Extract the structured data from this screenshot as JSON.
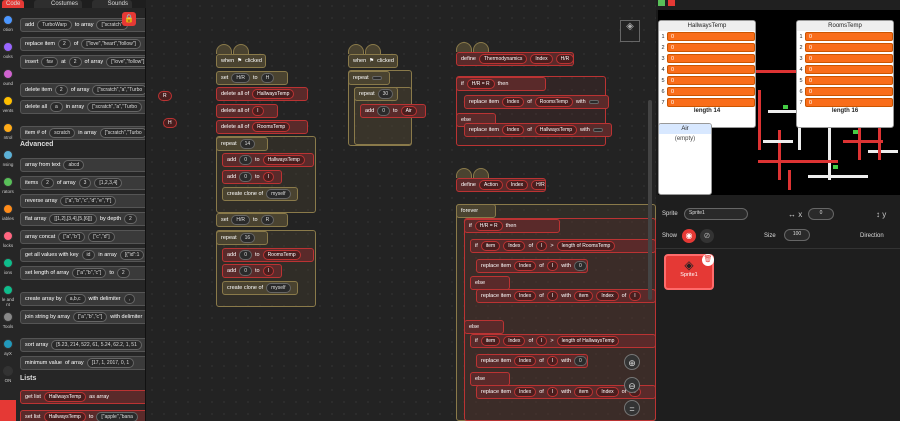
{
  "tabs": {
    "code": "Code",
    "costumes": "Costumes",
    "sounds": "Sounds"
  },
  "categories": [
    "otion",
    "ooks",
    "ound",
    "vents",
    "ntrol",
    "nsing",
    "rators",
    "iables",
    "locks",
    "ions",
    "le and nt",
    "Tools",
    "ayX",
    "ON"
  ],
  "palette": {
    "blocks": [
      "add",
      "TurboWarp",
      "to array",
      "[\"scratch\"",
      "replace item",
      "2",
      "of",
      "[\"love\",\"heart\",\"follow\"]",
      "insert",
      "fav",
      "at",
      "2",
      "of array",
      "[\"love\",\"follow\"]",
      "delete item",
      "2",
      "of array",
      "[\"scratch\",\"a\",\"Turbo",
      "delete all",
      "a",
      "in array",
      "[\"scratch\",\"a\",\"Turbo",
      "item # of",
      "scratch",
      "in array",
      "[\"scratch\",\"Turbo"
    ],
    "advanced_title": "Advanced",
    "advanced": [
      {
        "label": "array from text",
        "arg": "abcd"
      },
      {
        "label": "items",
        "arg": "2",
        "arg2": "3",
        "tail": "of array",
        "arg3": "[1,2,3,4]"
      },
      {
        "label": "reverse array",
        "arg": "[\"a\",\"b\",\"c\",\"d\",\"e\",\"f\"]"
      },
      {
        "label": "flat array",
        "arg": "[[1,2],[3,4],[5,[6]]]",
        "tail": "by depth",
        "arg2": "2"
      },
      {
        "label": "array concat",
        "arg": "[\"a\",\"b\"]",
        "arg2": "[\"c\",\"d\"]"
      },
      {
        "label": "get all values with key",
        "arg": "id",
        "tail": "in array",
        "arg2": "[{\"id\":1"
      },
      {
        "label": "set length of array",
        "arg": "[\"a\",\"b\",\"c\"]",
        "tail": "to",
        "arg2": "2"
      },
      {
        "label": "create array by",
        "arg": "a,b,c",
        "tail": "with delimiter",
        "arg2": ","
      },
      {
        "label": "join string by array",
        "arg": "[\"a\",\"b\",\"c\"]",
        "tail": "with delimiter"
      },
      {
        "label": "sort array",
        "arg": "[5.23, 214, 522, 61, 5.24, 62.2, 1, 51"
      },
      {
        "label": "minimum value",
        "tail": "of array",
        "arg": "[17, 1, 2017, 0, 1"
      }
    ],
    "lists_title": "Lists",
    "lists": [
      {
        "label": "get list",
        "arg": "HallwaysTemp",
        "tail": "as array"
      },
      {
        "label": "set list",
        "arg": "HallwaysTemp",
        "tail": "to",
        "arg2": "[\"apple\",\"bana"
      }
    ],
    "floating": [
      "R",
      "H"
    ]
  },
  "scripts": {
    "s1": {
      "hat": "when",
      "flag": "clicked",
      "set": "set",
      "var1": "H/R",
      "to": "to",
      "val1": "H",
      "delete_all": "delete all of",
      "list1": "HallwaysTemp",
      "list2": "I",
      "list3": "RoomsTemp",
      "repeat": "repeat",
      "n1": "14",
      "add": "add",
      "zero": "0",
      "to2": "to",
      "create": "create clone of",
      "myself": "myself",
      "val2": "R",
      "n2": "16"
    },
    "s2": {
      "hat": "when",
      "flag": "clicked",
      "repeat": "repeat",
      "n": "30",
      "add": "add",
      "zero": "0",
      "to": "to",
      "list": "Air"
    },
    "s3": {
      "define": "define",
      "name": "Thermodynamics",
      "arg1": "Index",
      "arg2": "H/R",
      "if": "if",
      "cond_l": "H/R",
      "eq": "=",
      "cond_r": "R",
      "then": "then",
      "replace": "replace item",
      "index": "Index",
      "of": "of",
      "list1": "RoomsTemp",
      "with": "with",
      "else": "else",
      "list2": "HallwaysTemp"
    },
    "s4": {
      "define": "define",
      "name": "Action",
      "arg1": "Index",
      "arg2": "H/R",
      "forever": "forever",
      "if": "if",
      "hr": "H/R",
      "eq": "=",
      "r": "R",
      "then": "then",
      "item": "item",
      "index": "Index",
      "of": "of",
      "I": "I",
      "gt": ">",
      "length_of": "length of",
      "rooms": "RoomsTemp",
      "hallways": "HallwaysTemp",
      "replace": "replace item",
      "with": "with",
      "zero": "0",
      "else": "else",
      "plus": "+",
      "one": "1"
    }
  },
  "monitors": {
    "hallways": {
      "title": "HallwaysTemp",
      "rows": [
        "0",
        "0",
        "0",
        "0",
        "0",
        "0",
        "0"
      ],
      "indices": [
        "1",
        "2",
        "3",
        "4",
        "5",
        "6",
        "7"
      ],
      "length": "length 14"
    },
    "rooms": {
      "title": "RoomsTemp",
      "rows": [
        "0",
        "0",
        "0",
        "0",
        "0",
        "0",
        "0"
      ],
      "indices": [
        "1",
        "2",
        "3",
        "4",
        "5",
        "6",
        "7"
      ],
      "length": "length 16"
    },
    "air": {
      "title": "Air",
      "empty": "(empty)"
    }
  },
  "sprite": {
    "label": "Sprite",
    "name": "Sprite1",
    "x_label": "x",
    "x": "0",
    "y_label": "y",
    "y": "0",
    "show": "Show",
    "size_label": "Size",
    "size": "100",
    "direction": "Direction",
    "thumb": "Sprite1"
  },
  "colors": {
    "accent": "#f96d1a",
    "blockBorder": "#8a7a4a",
    "red": "#b33333",
    "selected": "#e53935"
  }
}
